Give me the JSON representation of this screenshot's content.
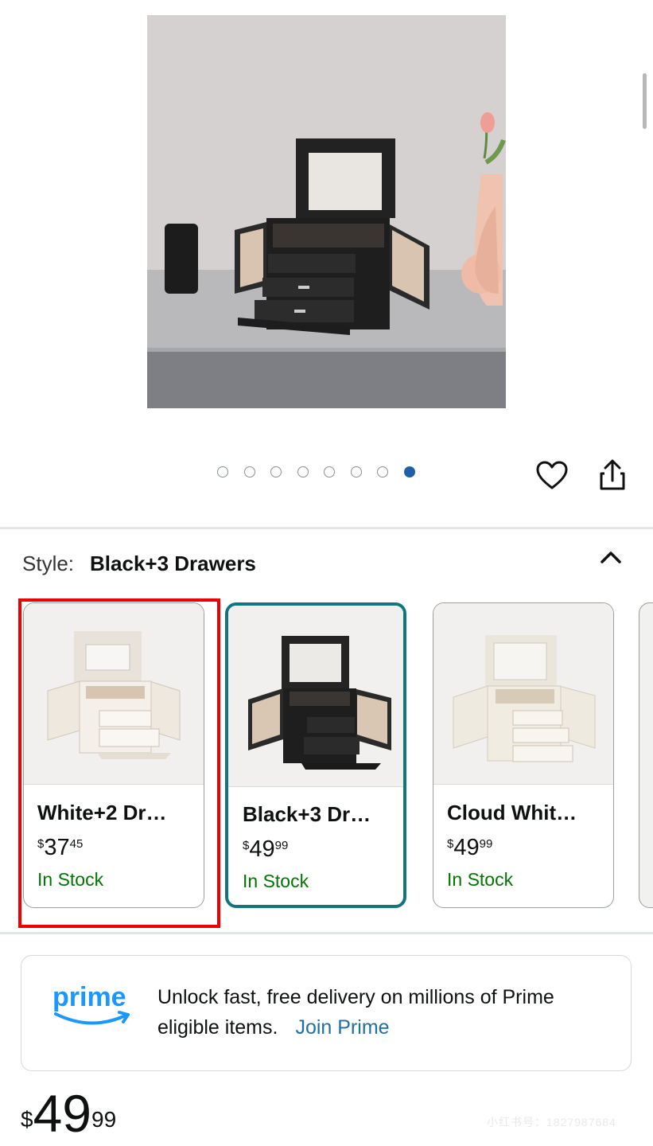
{
  "product": {
    "image_count": 8,
    "active_image_index": 7
  },
  "actions": {
    "favorite_icon": "heart-outline-icon",
    "share_icon": "share-icon"
  },
  "style": {
    "label": "Style:",
    "selected_value": "Black+3 Drawers",
    "toggle_icon": "chevron-up-icon"
  },
  "options": [
    {
      "name": "White+2 Dr…",
      "currency": "$",
      "price_whole": "37",
      "price_cents": "45",
      "stock": "In Stock"
    },
    {
      "name": "Black+3 Dr…",
      "currency": "$",
      "price_whole": "49",
      "price_cents": "99",
      "stock": "In Stock"
    },
    {
      "name": "Cloud Whit…",
      "currency": "$",
      "price_whole": "49",
      "price_cents": "99",
      "stock": "In Stock"
    }
  ],
  "prime": {
    "logo_text": "prime",
    "message": "Unlock fast, free delivery on millions of Prime eligible items.",
    "link": "Join Prime"
  },
  "price": {
    "currency": "$",
    "whole": "49",
    "cents": "99"
  },
  "watermark": "小红书号：1827987684",
  "colors": {
    "selected_border": "#117580",
    "highlight_border": "#ee0000",
    "stock_green": "#007600",
    "link_blue": "#1f6ea6",
    "active_dot": "#1f5fa8"
  }
}
